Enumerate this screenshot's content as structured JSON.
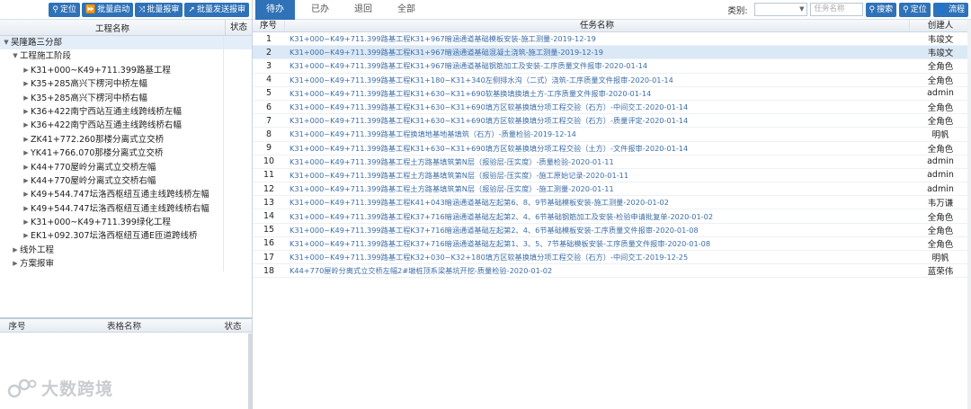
{
  "left_toolbar": {
    "buttons": [
      {
        "icon": "location-icon",
        "label": "定位"
      },
      {
        "icon": "fast-forward-icon",
        "label": "批量启动"
      },
      {
        "icon": "shuffle-icon",
        "label": "批量报审"
      },
      {
        "icon": "send-icon",
        "label": "批量发送报审"
      }
    ]
  },
  "tree_header": {
    "name": "工程名称",
    "status": "状态"
  },
  "tree": [
    {
      "label": "吴隆路三分部",
      "level": 0,
      "expanded": true
    },
    {
      "label": "工程施工阶段",
      "level": 1,
      "expanded": true
    },
    {
      "label": "K31+000~K49+711.399路基工程",
      "level": 2
    },
    {
      "label": "K35+285高兴下楞河中桥左幅",
      "level": 2
    },
    {
      "label": "K35+285高兴下楞河中桥右幅",
      "level": 2
    },
    {
      "label": "K36+422南宁西站互通主线跨线桥左幅",
      "level": 2
    },
    {
      "label": "K36+422南宁西站互通主线跨线桥右幅",
      "level": 2
    },
    {
      "label": "ZK41+772.260那楼分离式立交桥",
      "level": 2
    },
    {
      "label": "YK41+766.070那楼分离式立交桥",
      "level": 2
    },
    {
      "label": "K44+770屋岭分离式立交桥左幅",
      "level": 2
    },
    {
      "label": "K44+770屋岭分离式立交桥右幅",
      "level": 2
    },
    {
      "label": "K49+544.747坛洛西枢纽互通主线跨线桥左幅",
      "level": 2
    },
    {
      "label": "K49+544.747坛洛西枢纽互通主线跨线桥右幅",
      "level": 2
    },
    {
      "label": "K31+000~K49+711.399绿化工程",
      "level": 2
    },
    {
      "label": "EK1+092.307坛洛西枢纽互通E匝道跨线桥",
      "level": 2
    },
    {
      "label": "线外工程",
      "level": 1
    },
    {
      "label": "方案报审",
      "level": 1
    }
  ],
  "lower_table_header": {
    "no": "序号",
    "name": "表格名称",
    "status": "状态"
  },
  "watermark": {
    "text": "大数跨境"
  },
  "tabs": [
    {
      "label": "待办",
      "active": true
    },
    {
      "label": "已办"
    },
    {
      "label": "退回"
    },
    {
      "label": "全部"
    }
  ],
  "search": {
    "category_label": "类别:",
    "category_value": "",
    "name_placeholder": "任务名称",
    "search_button": "搜索",
    "locate_button": "定位",
    "flow_button": "流程"
  },
  "grid_header": {
    "no": "序号",
    "task": "任务名称",
    "creator": "创建人"
  },
  "rows": [
    {
      "no": "1",
      "task": "K31+000~K49+711.399路基工程K31+967暗涵通道基础模板安装-施工测量-2019-12-19",
      "creator": "韦竣文"
    },
    {
      "no": "2",
      "task": "K31+000~K49+711.399路基工程K31+967暗涵通道基础混凝土浇筑-施工测量-2019-12-19",
      "creator": "韦竣文",
      "selected": true
    },
    {
      "no": "3",
      "task": "K31+000~K49+711.399路基工程K31+967暗涵通道基础钢筋加工及安装-工序质量文件报审-2020-01-14",
      "creator": "全角色"
    },
    {
      "no": "4",
      "task": "K31+000~K49+711.399路基工程K31+180~K31+340左侧排水沟（二式）浇筑-工序质量文件报审-2020-01-14",
      "creator": "全角色"
    },
    {
      "no": "5",
      "task": "K31+000~K49+711.399路基工程K31+630~K31+690软基换填换填土方-工序质量文件报审-2020-01-14",
      "creator": "admin"
    },
    {
      "no": "6",
      "task": "K31+000~K49+711.399路基工程K31+630~K31+690填方区软基换填分项工程交验（石方）-中间交工-2020-01-14",
      "creator": "全角色"
    },
    {
      "no": "7",
      "task": "K31+000~K49+711.399路基工程K31+630~K31+690填方区软基换填分项工程交验（石方）-质量评定-2020-01-14",
      "creator": "全角色"
    },
    {
      "no": "8",
      "task": "K31+000~K49+711.399路基工程换填地基地基填筑（石方）-质量检验-2019-12-14",
      "creator": "明帆"
    },
    {
      "no": "9",
      "task": "K31+000~K49+711.399路基工程K31+630~K31+690填方区软基换填分项工程交验（土方）-文件报审-2020-01-14",
      "creator": "全角色"
    },
    {
      "no": "10",
      "task": "K31+000~K49+711.399路基工程土方路基填筑第N层（报验层-压实度）-质量检验-2020-01-11",
      "creator": "admin"
    },
    {
      "no": "11",
      "task": "K31+000~K49+711.399路基工程土方路基填筑第N层（报验层-压实度）-施工原始记录-2020-01-11",
      "creator": "admin"
    },
    {
      "no": "12",
      "task": "K31+000~K49+711.399路基工程土方路基填筑第N层（报验层-压实度）-施工测量-2020-01-11",
      "creator": "admin"
    },
    {
      "no": "13",
      "task": "K31+000~K49+711.399路基工程K41+043暗涵通道基础左起第6、8、9节基础模板安装-施工测量-2020-01-02",
      "creator": "韦万谦"
    },
    {
      "no": "14",
      "task": "K31+000~K49+711.399路基工程K37+716暗涵通道基础左起第2、4、6节基础钢筋加工及安装-检验申请批复单-2020-01-02",
      "creator": "全角色"
    },
    {
      "no": "15",
      "task": "K31+000~K49+711.399路基工程K37+716暗涵通道基础左起第2、4、6节基础模板安装-工序质量文件报审-2020-01-08",
      "creator": "全角色"
    },
    {
      "no": "16",
      "task": "K31+000~K49+711.399路基工程K37+716暗涵通道基础左起第1、3、5、7节基础模板安装-工序质量文件报审-2020-01-08",
      "creator": "全角色"
    },
    {
      "no": "17",
      "task": "K31+000~K49+711.399路基工程K32+030~K32+180填方区软基换填分项工程交验（石方）-中间交工-2019-12-25",
      "creator": "明帆"
    },
    {
      "no": "18",
      "task": "K44+770屋岭分离式立交桥左幅2#墩桩顶系梁基坑开挖-质量检验-2020-01-02",
      "creator": "蓝荣伟"
    }
  ]
}
